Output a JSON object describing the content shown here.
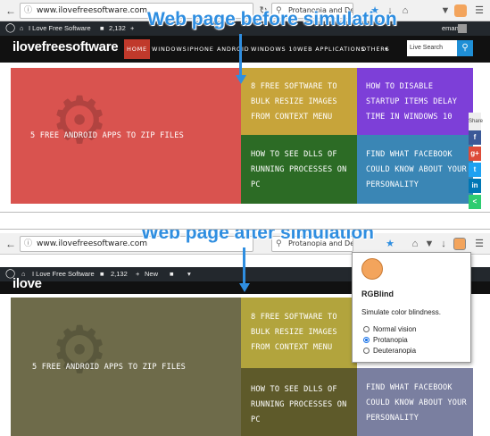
{
  "captions": {
    "before": "Web page before simulation",
    "after": "Web page after simulation"
  },
  "top": {
    "url": "www.ilovefreesoftware.com",
    "search": "Protanopia and Deute",
    "admin": {
      "site": "I Love Free Software",
      "count": "2,132",
      "user": "eman"
    },
    "logo": "ilovefreesoftware",
    "menu": [
      "HOME",
      "WINDOWS",
      "IPHONE",
      "ANDROID",
      "WINDOWS 10",
      "WEB APPLICATIONS",
      "OTHERS"
    ],
    "site_search_placeholder": "Live Search",
    "tiles": [
      {
        "text": "5 FREE ANDROID APPS TO ZIP FILES",
        "color": "#d9534f"
      },
      {
        "text": "8 FREE SOFTWARE TO BULK RESIZE IMAGES FROM CONTEXT MENU",
        "color": "#c7a43a"
      },
      {
        "text": "HOW TO DISABLE STARTUP ITEMS DELAY TIME IN WINDOWS 10",
        "color": "#7d3fd8"
      },
      {
        "text": "HOW TO SEE DLLS OF RUNNING PROCESSES ON PC",
        "color": "#2c6b25"
      },
      {
        "text": "FIND WHAT FACEBOOK COULD KNOW ABOUT YOUR PERSONALITY",
        "color": "#3a86b5"
      }
    ],
    "share": {
      "label": "Share",
      "buttons": [
        {
          "glyph": "f",
          "color": "#3b5998"
        },
        {
          "glyph": "g+",
          "color": "#dd4b39"
        },
        {
          "glyph": "t",
          "color": "#1da1f2"
        },
        {
          "glyph": "in",
          "color": "#0077b5"
        },
        {
          "glyph": "<",
          "color": "#2ecc71"
        }
      ]
    }
  },
  "bottom": {
    "url": "www.ilovefreesoftware.com",
    "search": "Protanopia and Deute",
    "admin": {
      "site": "I Love Free Software",
      "count": "2,132",
      "new": "New"
    },
    "logo": "ilove",
    "tiles": [
      {
        "text": "5 FREE ANDROID APPS TO ZIP FILES",
        "color": "#6e6b4a"
      },
      {
        "text": "8 FREE SOFTWARE TO BULK RESIZE IMAGES FROM CONTEXT MENU",
        "color": "#b2a43d"
      },
      {
        "text": "HOW TO SEE DLLS OF RUNNING PROCESSES ON PC",
        "color": "#5e5a2a"
      },
      {
        "text": "FIND WHAT FACEBOOK COULD KNOW ABOUT YOUR PERSONALITY",
        "color": "#7a7fa0"
      }
    ],
    "popup": {
      "title": "RGBlind",
      "description": "Simulate color blindness.",
      "options": [
        {
          "label": "Normal vision",
          "checked": false
        },
        {
          "label": "Protanopia",
          "checked": true
        },
        {
          "label": "Deuteranopia",
          "checked": false
        }
      ]
    }
  },
  "icons": {
    "back": "back-arrow-icon",
    "forward": "forward-arrow-icon",
    "info": "info-icon",
    "search": "search-icon",
    "star": "bookmark-star-icon",
    "download": "download-icon",
    "home": "home-icon",
    "pocket": "pocket-icon",
    "extension": "rgblind-extension-icon",
    "menu": "hamburger-menu-icon",
    "wordpress": "wordpress-icon"
  }
}
